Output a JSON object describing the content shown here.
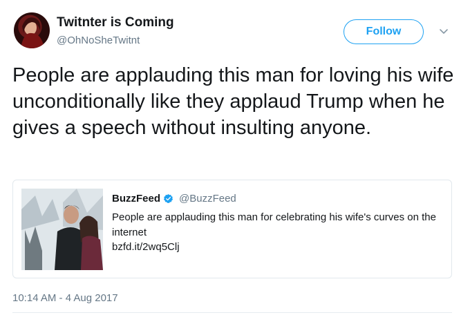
{
  "tweet": {
    "author": {
      "display_name": "Twitnter is Coming",
      "handle": "@OhNoSheTwitnt"
    },
    "follow_label": "Follow",
    "text": "People are applauding this man for loving his wife unconditionally like they applaud Trump when he gives a speech without insulting anyone.",
    "timestamp": "10:14 AM - 4 Aug 2017"
  },
  "quoted_tweet": {
    "display_name": "BuzzFeed",
    "handle": "@BuzzFeed",
    "text": "People are applauding this man for celebrating his wife's curves on the internet",
    "link": "bzfd.it/2wq5Clj"
  },
  "colors": {
    "accent": "#1da1f2",
    "secondary_text": "#657786",
    "border": "#e1e8ed"
  }
}
